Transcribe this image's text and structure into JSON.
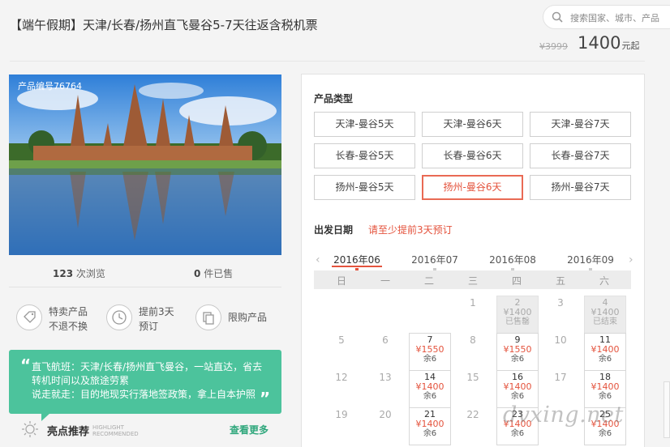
{
  "header": {
    "title": "【端午假期】天津/长春/扬州直飞曼谷5-7天往返含税机票",
    "search_placeholder": "搜索国家、城市、产品",
    "price_old": "¥3999",
    "price_now": "1400",
    "price_unit": "元起"
  },
  "product": {
    "number": "产品编号76764",
    "views_count": "123",
    "views_label": "次浏览",
    "sold_count": "0",
    "sold_label": "件已售"
  },
  "features": [
    {
      "icon": "tag-icon",
      "line1": "特卖产品",
      "line2": "不退不换"
    },
    {
      "icon": "clock-icon",
      "line1": "提前3天",
      "line2": "预订"
    },
    {
      "icon": "copy-icon",
      "line1": "限购产品",
      "line2": ""
    }
  ],
  "highlight": {
    "text1": "直飞航班：天津/长春/扬州直飞曼谷，一站直达，省去转机时间以及旅途劳累",
    "text2": "说走就走：目的地现实行落地签政策，拿上自本护照",
    "title": "亮点推荐",
    "en1": "HIGHLIGHT",
    "en2": "RECOMMENDED",
    "more": "查看更多"
  },
  "booking": {
    "type_title": "产品类型",
    "types": [
      "天津-曼谷5天",
      "天津-曼谷6天",
      "天津-曼谷7天",
      "长春-曼谷5天",
      "长春-曼谷6天",
      "长春-曼谷7天",
      "扬州-曼谷5天",
      "扬州-曼谷6天",
      "扬州-曼谷7天"
    ],
    "selected_type": "扬州-曼谷6天",
    "date_title": "出发日期",
    "date_hint": "请至少提前3天预订",
    "months": [
      "2016年06",
      "2016年07",
      "2016年08",
      "2016年09"
    ],
    "selected_month": "2016年06",
    "weekdays": [
      "日",
      "一",
      "二",
      "三",
      "四",
      "五",
      "六"
    ],
    "plain_days": [
      "1",
      "3",
      "5",
      "6",
      "8",
      "10",
      "12",
      "13",
      "15",
      "17",
      "19",
      "20",
      "22"
    ],
    "cells": [
      {
        "day": "2",
        "price": "¥1400",
        "status": "已售罄",
        "gray": true
      },
      {
        "day": "4",
        "price": "¥1400",
        "status": "已结束",
        "gray": true
      },
      {
        "day": "7",
        "price": "¥1550",
        "status": "余6",
        "gray": false
      },
      {
        "day": "9",
        "price": "¥1550",
        "status": "余6",
        "gray": false
      },
      {
        "day": "11",
        "price": "¥1400",
        "status": "余6",
        "gray": false
      },
      {
        "day": "14",
        "price": "¥1400",
        "status": "余6",
        "gray": false
      },
      {
        "day": "16",
        "price": "¥1400",
        "status": "余6",
        "gray": false
      },
      {
        "day": "18",
        "price": "¥1400",
        "status": "余6",
        "gray": false
      },
      {
        "day": "21",
        "price": "¥1400",
        "status": "余6",
        "gray": false
      },
      {
        "day": "23",
        "price": "¥1400",
        "status": "余6",
        "gray": false
      },
      {
        "day": "25",
        "price": "¥1400",
        "status": "余6",
        "gray": false
      }
    ]
  },
  "watermark": "dvxing.net",
  "colors": {
    "accent": "#e4533d",
    "green": "#4cc39c",
    "link": "#2fa77c"
  }
}
